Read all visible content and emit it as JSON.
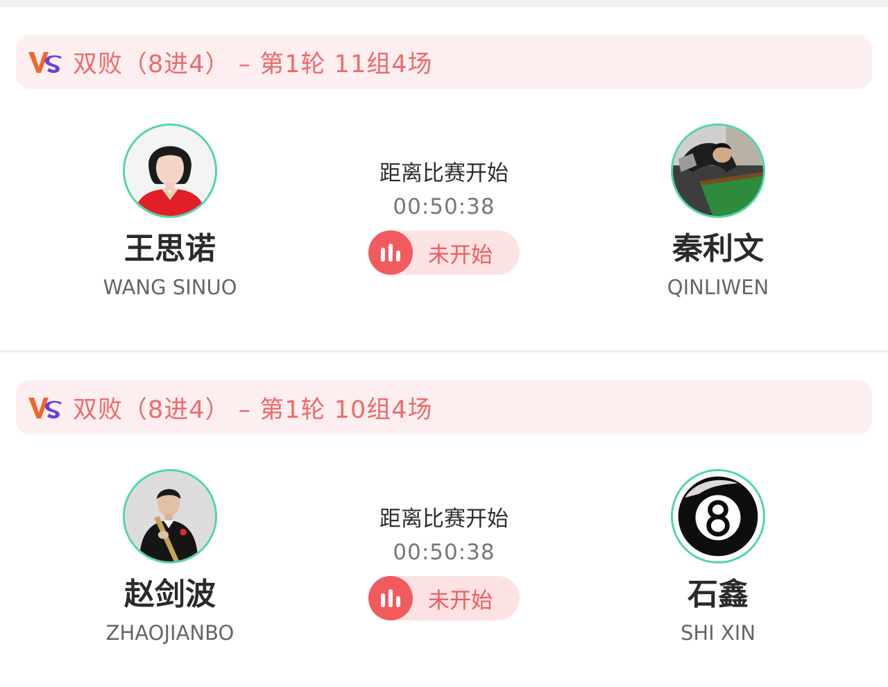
{
  "matches": [
    {
      "header_title": "双败（8进4） – 第1轮 11组4场",
      "countdown_label": "距离比赛开始",
      "countdown_time": "00:50:38",
      "status": "未开始",
      "player_left": {
        "name_cn": "王思诺",
        "name_en": "WANG SINUO"
      },
      "player_right": {
        "name_cn": "秦利文",
        "name_en": "QINLIWEN"
      }
    },
    {
      "header_title": "双败（8进4） – 第1轮 10组4场",
      "countdown_label": "距离比赛开始",
      "countdown_time": "00:50:38",
      "status": "未开始",
      "player_left": {
        "name_cn": "赵剑波",
        "name_en": "ZHAOJIANBO"
      },
      "player_right": {
        "name_cn": "石鑫",
        "name_en": "SHI XIN"
      }
    }
  ],
  "icons": {
    "vs_logo": "vs-logo-icon",
    "status": "bar-chart-icon"
  },
  "colors": {
    "accent_red": "#f25b5d",
    "header_bg": "#fdeff0",
    "avatar_ring": "#4fd6a6",
    "vs_orange": "#f0652a",
    "vs_purple": "#6a3fe0"
  }
}
